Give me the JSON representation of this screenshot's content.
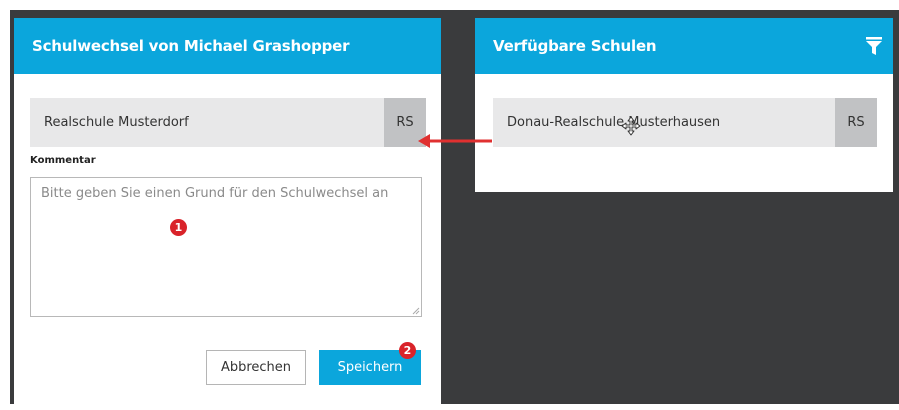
{
  "left_panel": {
    "title": "Schulwechsel von Michael Grashopper",
    "selected_school": {
      "name": "Realschule Musterdorf",
      "badge": "RS"
    },
    "comment_label": "Kommentar",
    "comment_placeholder": "Bitte geben Sie einen Grund für den Schulwechsel an",
    "comment_value": "",
    "cancel_label": "Abbrechen",
    "save_label": "Speichern"
  },
  "right_panel": {
    "title": "Verfügbare Schulen",
    "filter_icon": "filter-icon",
    "schools": [
      {
        "name": "Donau-Realschule Musterhausen",
        "badge": "RS"
      }
    ]
  },
  "annotations": {
    "marker_1": "1",
    "marker_2": "2",
    "arrow_color": "#e03030"
  },
  "colors": {
    "accent": "#0ba6dc",
    "background": "#3a3b3d",
    "item_bg": "#e8e8e9",
    "badge_bg": "#c1c2c4",
    "marker": "#d9232a"
  }
}
